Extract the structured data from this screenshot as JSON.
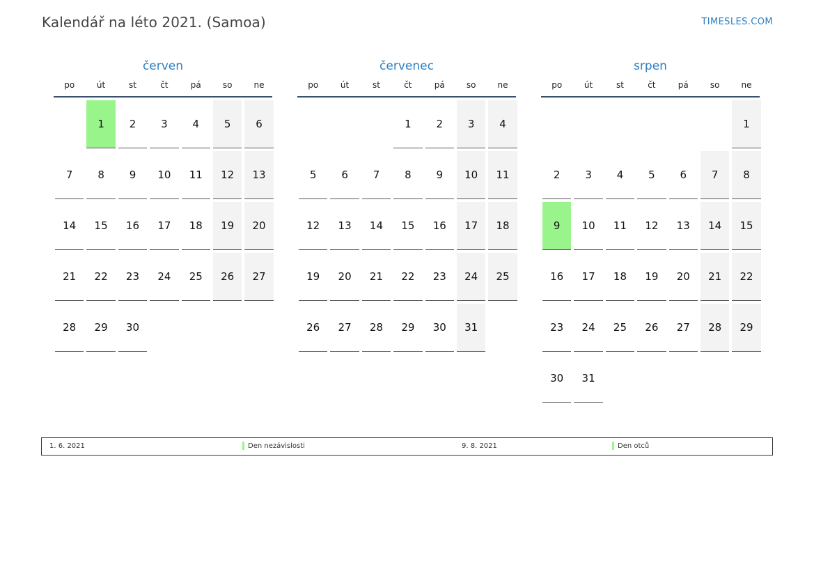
{
  "header": {
    "title": "Kalendář na léto 2021. (Samoa)",
    "brand": "TIMESLES.COM"
  },
  "weekdays": [
    "po",
    "út",
    "st",
    "čt",
    "pá",
    "so",
    "ne"
  ],
  "colors": {
    "accent": "#2f7fc1",
    "holiday": "#99f58b",
    "weekend": "#f3f3f3"
  },
  "months": [
    {
      "name": "červen",
      "first_weekday": 2,
      "days": 30,
      "holidays": [
        1
      ]
    },
    {
      "name": "červenec",
      "first_weekday": 4,
      "days": 31,
      "holidays": []
    },
    {
      "name": "srpen",
      "first_weekday": 7,
      "days": 31,
      "holidays": [
        9
      ]
    }
  ],
  "legend": [
    {
      "date": "1. 6. 2021",
      "name": "Den nezávislosti"
    },
    {
      "date": "9. 8. 2021",
      "name": "Den otců"
    }
  ]
}
